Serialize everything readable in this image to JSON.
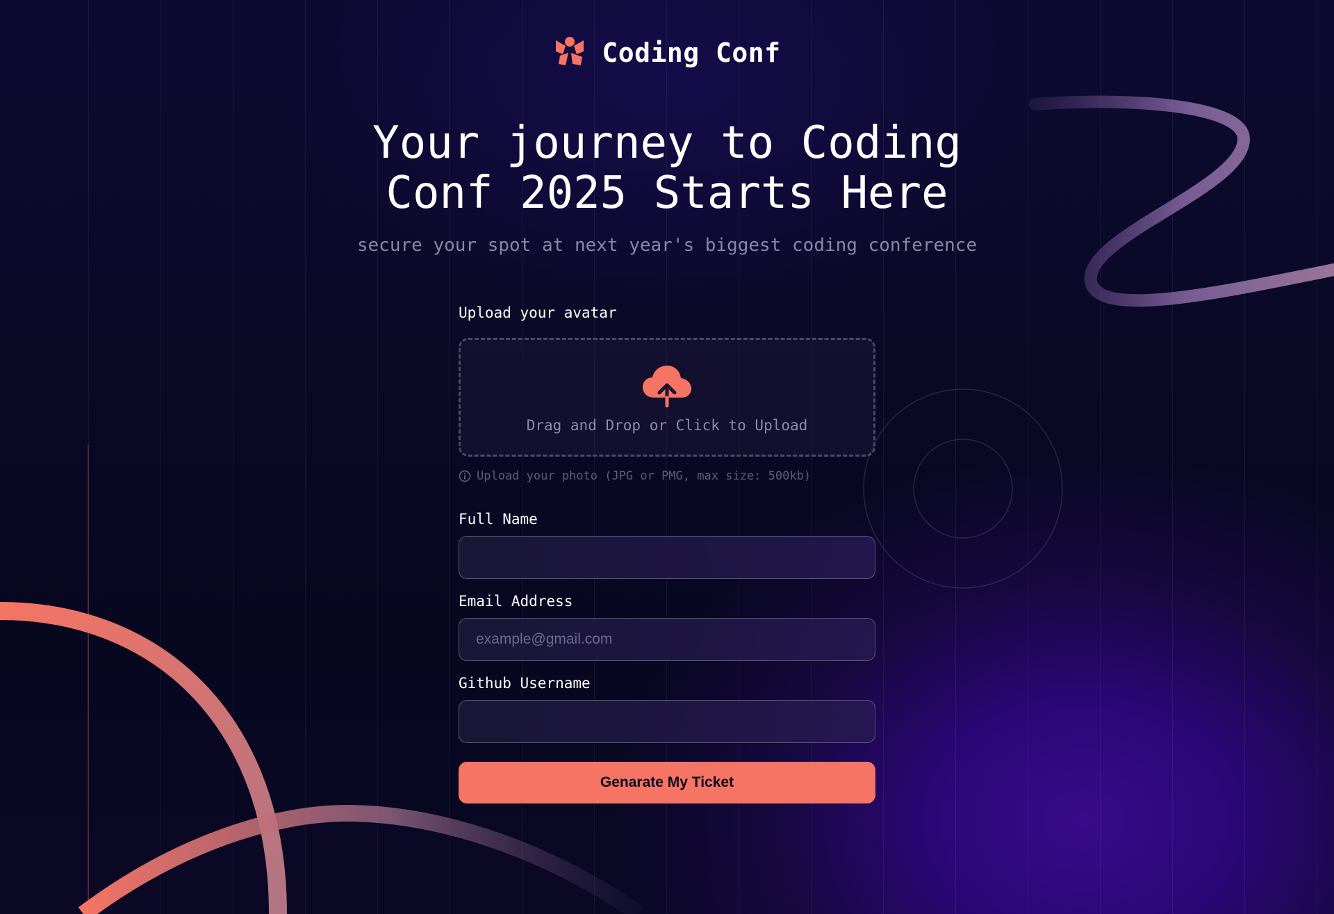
{
  "header": {
    "logo_icon": "coding-conf-logo-icon",
    "brand_name": "Coding Conf"
  },
  "hero": {
    "title_line1": "Your journey to Coding",
    "title_line2": "Conf 2025 Starts Here",
    "subtitle": "secure your spot at next year's biggest coding conference"
  },
  "form": {
    "avatar_label": "Upload your avatar",
    "upload_icon": "cloud-upload-icon",
    "upload_text": "Drag and Drop or Click to Upload",
    "hint_icon": "info-icon",
    "hint_text": "Upload your photo (JPG or PMG, max size: 500kb)",
    "full_name": {
      "label": "Full Name",
      "value": "",
      "placeholder": ""
    },
    "email": {
      "label": "Email Address",
      "value": "",
      "placeholder": "example@gmail.com"
    },
    "github": {
      "label": "Github Username",
      "value": "",
      "placeholder": ""
    },
    "submit_label": "Genarate My Ticket"
  },
  "colors": {
    "accent": "#f57463",
    "background_dark": "#0a0926",
    "background_glow": "#3a0a8a",
    "muted_text": "#8a86a6"
  }
}
